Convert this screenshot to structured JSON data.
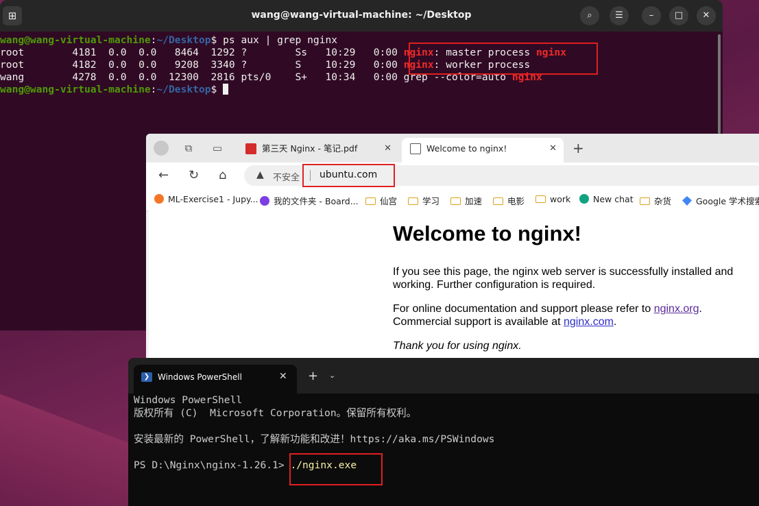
{
  "terminal": {
    "title": "wang@wang-virtual-machine: ~/Desktop",
    "prompt_user": "wang@wang-virtual-machine",
    "prompt_sep": ":",
    "prompt_path": "~/Desktop",
    "prompt_end": "$ ",
    "command": "ps aux | grep nginx",
    "rows": [
      {
        "prefix": "root        4181  0.0  0.0   8464  1292 ?        Ss   10:29   0:00 ",
        "hl1": "nginx",
        "mid": ": master process ",
        "hl2": "nginx"
      },
      {
        "prefix": "root        4182  0.0  0.0   9208  3340 ?        S    10:29   0:00 ",
        "hl1": "nginx",
        "mid": ": worker process",
        "hl2": ""
      },
      {
        "prefix": "wang        4278  0.0  0.0  12300  2816 pts/0    S+   10:34   0:00 grep --color=auto ",
        "hl1": "nginx",
        "mid": "",
        "hl2": ""
      }
    ],
    "buttons": {
      "newtab": "⊞",
      "search": "⌕",
      "menu": "☰",
      "minimize": "–",
      "maximize": "□",
      "close": "✕"
    }
  },
  "browser": {
    "tabs": [
      {
        "title": "第三天 Nginx - 笔记.pdf",
        "favicon": "pdf-icon",
        "close": "✕"
      },
      {
        "title": "Welcome to nginx!",
        "favicon": "page-icon",
        "close": "✕"
      }
    ],
    "newtab": "+",
    "nav": {
      "back": "←",
      "reload": "↻",
      "home": "⌂"
    },
    "address": {
      "security": "不安全",
      "url": "ubuntu.com"
    },
    "bookmarks": [
      {
        "label": "ML-Exercise1 - Jupy...",
        "icon": "jupyter-icon",
        "color": "#f37626"
      },
      {
        "label": "我的文件夹 - Board...",
        "icon": "board-icon",
        "color": "#7b3fe4"
      },
      {
        "label": "仙宫",
        "icon": "folder-icon"
      },
      {
        "label": "学习",
        "icon": "folder-icon"
      },
      {
        "label": "加速",
        "icon": "folder-icon"
      },
      {
        "label": "电影",
        "icon": "folder-icon"
      },
      {
        "label": "work",
        "icon": "folder-icon"
      },
      {
        "label": "New chat",
        "icon": "chatgpt-icon",
        "color": "#10a37f"
      },
      {
        "label": "杂货",
        "icon": "folder-icon"
      },
      {
        "label": "Google 学术搜索",
        "icon": "scholar-icon",
        "color": "#4285f4"
      }
    ],
    "page": {
      "heading": "Welcome to nginx!",
      "p1": "If you see this page, the nginx web server is successfully installed and working. Further configuration is required.",
      "p2_a": "For online documentation and support please refer to ",
      "link1": "nginx.org",
      "p2_b": ".",
      "p2_c": "Commercial support is available at ",
      "link2": "nginx.com",
      "p2_d": ".",
      "p3": "Thank you for using nginx."
    }
  },
  "powershell": {
    "tab_title": "Windows PowerShell",
    "tab_close": "✕",
    "plus": "+",
    "dropdown": "⌄",
    "lines": [
      "Windows PowerShell",
      "版权所有 (C)  Microsoft Corporation。保留所有权利。",
      "",
      "安装最新的 PowerShell，了解新功能和改进！https://aka.ms/PSWindows",
      ""
    ],
    "prompt": "PS D:\\Nginx\\nginx-1.26.1> ",
    "command": "./nginx.exe"
  },
  "colors": {
    "highlight_box": "#e02020",
    "terminal_bg": "#300a24",
    "powershell_bg": "#0c0c0c"
  }
}
